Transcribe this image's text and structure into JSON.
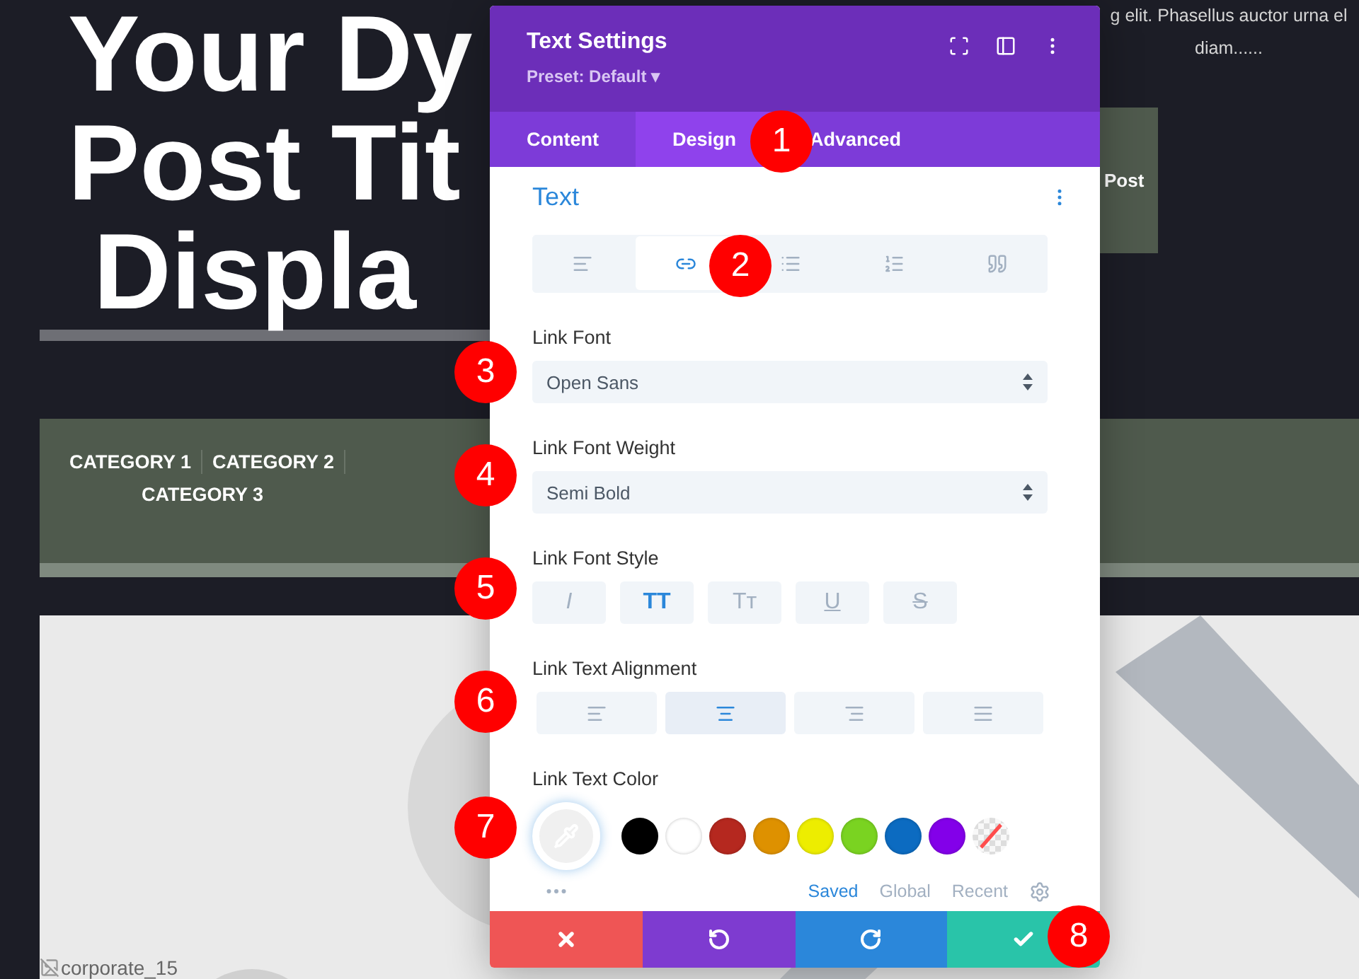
{
  "page": {
    "title_lines": [
      "Your Dy",
      "Post Tit",
      "Displa"
    ],
    "excerpt_lines": [
      "g elit. Phasellus auctor urna el",
      "diam......"
    ],
    "read_more": "Post",
    "categories": [
      "CATEGORY 1",
      "CATEGORY 2",
      "CATEGORY 3"
    ],
    "image_alt": "corporate_15"
  },
  "modal": {
    "title": "Text Settings",
    "preset": "Preset: Default ▾",
    "tabs": [
      {
        "label": "Content",
        "selected": false
      },
      {
        "label": "Design",
        "selected": true
      },
      {
        "label": "Advanced",
        "selected": false
      }
    ],
    "section": "Text",
    "subtabs": [
      {
        "selected": false
      },
      {
        "selected": true
      },
      {
        "selected": false
      },
      {
        "selected": false
      },
      {
        "selected": false
      }
    ],
    "fields": [
      {
        "kind": "select",
        "label": "Link Font",
        "value": "Open Sans"
      },
      {
        "kind": "select",
        "label": "Link Font Weight",
        "value": "Semi Bold"
      },
      {
        "kind": "styles",
        "label": "Link Font Style",
        "options": [
          {
            "kind": "italic",
            "label": "I",
            "selected": false
          },
          {
            "kind": "upper",
            "label": "TT",
            "selected": true
          },
          {
            "kind": "caps",
            "label": "Tт",
            "selected": false
          },
          {
            "kind": "underline",
            "label": "U",
            "selected": false
          },
          {
            "kind": "strike",
            "label": "S",
            "selected": false
          }
        ]
      },
      {
        "kind": "align",
        "label": "Link Text Alignment",
        "options": [
          {
            "selected": false
          },
          {
            "selected": true
          },
          {
            "selected": false
          },
          {
            "selected": false
          }
        ]
      },
      {
        "kind": "color",
        "label": "Link Text Color",
        "swatches": [
          {
            "kind": "solid",
            "color": "#000000"
          },
          {
            "kind": "solid",
            "color": "#ffffff"
          },
          {
            "kind": "solid",
            "color": "#b5281f"
          },
          {
            "kind": "solid",
            "color": "#de9100"
          },
          {
            "kind": "solid",
            "color": "#eded00"
          },
          {
            "kind": "solid",
            "color": "#7ad321"
          },
          {
            "kind": "solid",
            "color": "#0c6bc1"
          },
          {
            "kind": "solid",
            "color": "#8300e9"
          },
          {
            "kind": "clear"
          }
        ],
        "palettes": [
          {
            "label": "Saved",
            "selected": true
          },
          {
            "label": "Global",
            "selected": false
          },
          {
            "label": "Recent",
            "selected": false
          }
        ]
      }
    ]
  },
  "callouts": [
    "1",
    "2",
    "3",
    "4",
    "5",
    "6",
    "7",
    "8"
  ]
}
